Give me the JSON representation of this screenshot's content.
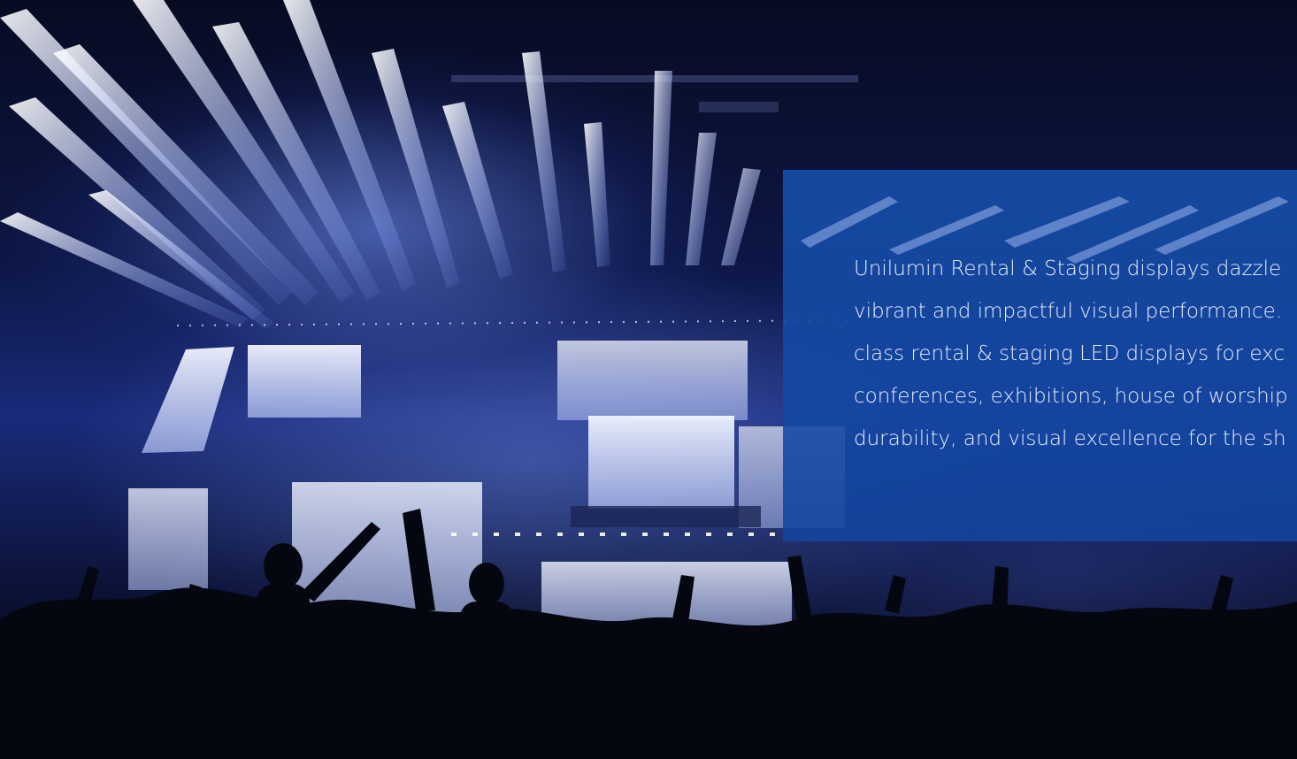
{
  "hero": {
    "image": "concert-stage-scene",
    "accent_color": "#1a4fa8"
  },
  "intro": {
    "lines": [
      "Unilumin Rental & Staging displays dazzle",
      "vibrant and impactful visual performance.",
      "class rental & staging LED displays for exc",
      "conferences, exhibitions, house of worship",
      "durability, and visual excellence for the sh"
    ]
  }
}
